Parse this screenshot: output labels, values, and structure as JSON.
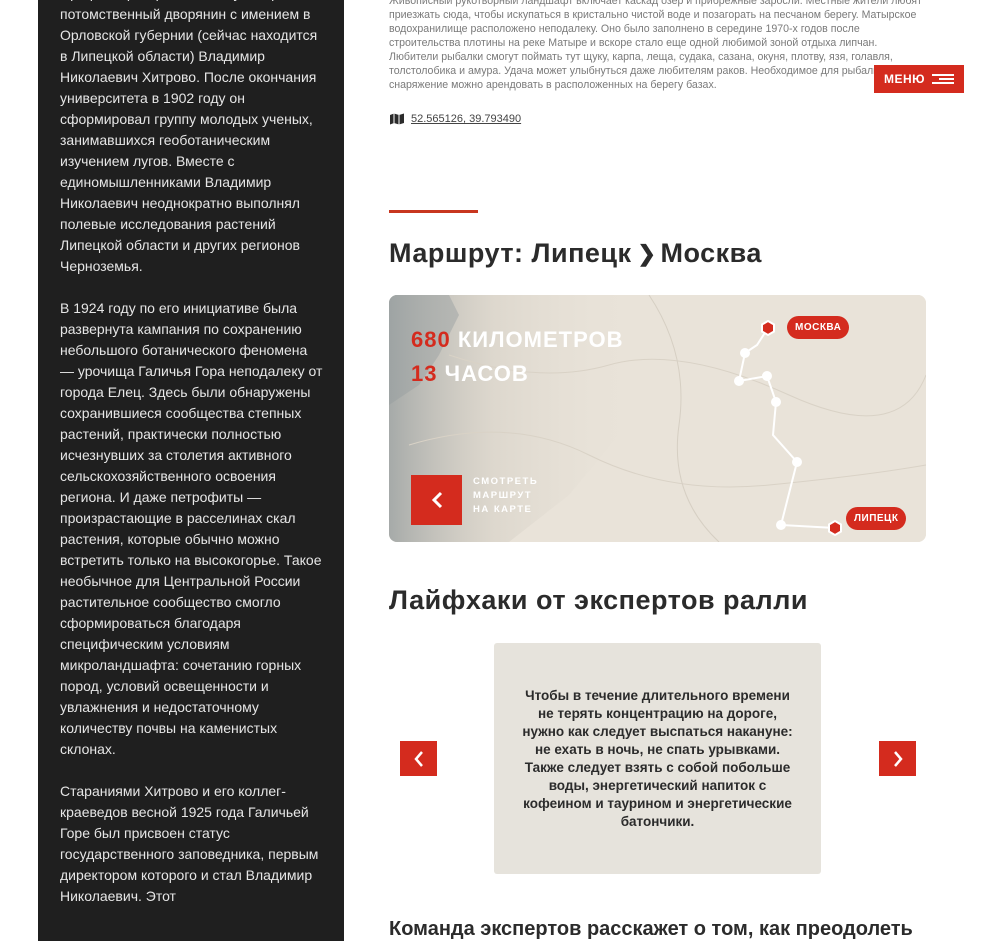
{
  "sidebar": {
    "paragraphs": [
      "Профессор Воронежского университета потомственный дворянин с имением в Орловской губернии (сейчас находится в Липецкой области) Владимир Николаевич Хитрово. После окончания университета в 1902 году он сформировал группу молодых ученых, занимавшихся геоботаническим изучением лугов. Вместе с единомышленниками Владимир Николаевич неоднократно выполнял полевые исследования растений Липецкой области и других регионов Черноземья.",
      "В 1924 году по его инициативе была развернута кампания по сохранению небольшого ботанического феномена — урочища Галичья Гора неподалеку от города Елец. Здесь были обнаружены сохранившиеся сообщества степных растений, практически полностью исчезнувших за столетия активного сельскохозяйственного освоения региона. И даже петрофиты — произрастающие в расселинах скал растения, которые обычно можно встретить только на высокогорье. Такое необычное для Центральной России растительное сообщество смогло сформироваться благодаря специфическим условиям микроландшафта: сочетанию горных пород, условий освещенности и увлажнения и недостаточному количеству почвы на каменистых склонах.",
      "Стараниями Хитрово и его коллег-краеведов весной 1925 года Галичьей Горе был присвоен статус государственного заповедника, первым директором которого и стал Владимир Николаевич. Этот"
    ]
  },
  "intro": {
    "text": "Живописный рукотворный ландшафт включает каскад озер и прибрежные заросли. Местные жители любят приезжать сюда, чтобы искупаться в кристально чистой воде и позагорать на песчаном берегу. Матырское водохранилище расположено неподалеку. Оно было заполнено в середине 1970-х годов после строительства плотины на реке Матыре и вскоре стало еще одной любимой зоной отдыха липчан. Любители рыбалки смогут поймать тут щуку, карпа, леща, судака, сазана, окуня, плотву, язя, голавля, толстолобика и амура. Удача может улыбнуться даже любителям раков. Необходимое для рыбалки снаряжение можно арендовать в расположенных на берегу базах."
  },
  "coords": {
    "icon": "map-icon",
    "text": "52.565126, 39.793490"
  },
  "menu": {
    "label": "МЕНЮ"
  },
  "route": {
    "prefix": "Маршрут:",
    "from": "Липецк",
    "arrow": "❯",
    "to": "Москва",
    "distance_value": "680",
    "distance_label": "КИЛОМЕТРОВ",
    "time_value": "13",
    "time_label": "ЧАСОВ",
    "show_map_lines": [
      "СМОТРЕТЬ",
      "МАРШРУТ",
      "НА КАРТЕ"
    ],
    "badge_top": "МОСКВА",
    "badge_bottom": "ЛИПЕЦК"
  },
  "tips": {
    "title": "Лайфхаки от экспертов ралли",
    "card_text": "Чтобы в течение длительного времени не терять концентрацию на дороге, нужно как следует выспаться накануне: не ехать в ночь, не спать урывками. Также следует взять с собой побольше воды, энергетический напиток с кофеином и таурином и энергетические батончики."
  },
  "team": {
    "title": "Команда экспертов расскажет о том, как преодолеть"
  },
  "colors": {
    "accent": "#d42b1e",
    "sidebar_bg": "#1f1f1f",
    "card_bg": "#e6e3dc"
  }
}
